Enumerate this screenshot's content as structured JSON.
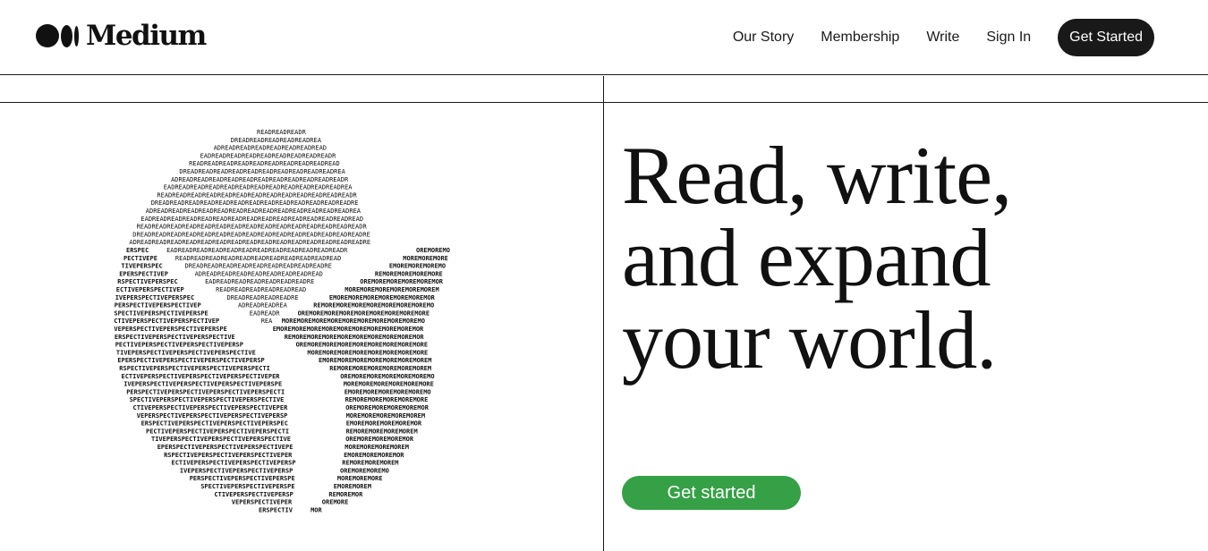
{
  "brand": {
    "name": "Medium"
  },
  "nav": {
    "links": [
      "Our Story",
      "Membership",
      "Write",
      "Sign In"
    ],
    "cta": "Get Started"
  },
  "hero": {
    "lines": [
      "Read, write,",
      "and expand",
      "your world."
    ],
    "cta": "Get started"
  },
  "art": {
    "words": {
      "top": "READ",
      "left": "PERSPECTIVE",
      "right": "MORE"
    }
  },
  "colors": {
    "text": "#191919",
    "cta_green": "#35a046",
    "background": "#ffffff"
  }
}
